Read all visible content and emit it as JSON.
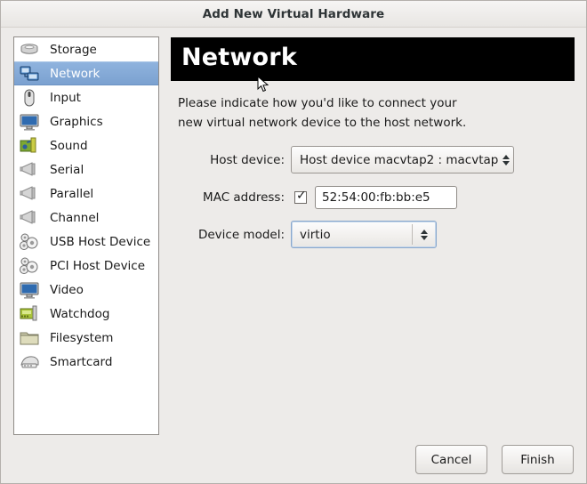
{
  "window": {
    "title": "Add New Virtual Hardware"
  },
  "sidebar": {
    "items": [
      {
        "label": "Storage",
        "icon": "storage-icon",
        "selected": false
      },
      {
        "label": "Network",
        "icon": "network-icon",
        "selected": true
      },
      {
        "label": "Input",
        "icon": "mouse-icon",
        "selected": false
      },
      {
        "label": "Graphics",
        "icon": "monitor-icon",
        "selected": false
      },
      {
        "label": "Sound",
        "icon": "sound-icon",
        "selected": false
      },
      {
        "label": "Serial",
        "icon": "serial-port-icon",
        "selected": false
      },
      {
        "label": "Parallel",
        "icon": "parallel-port-icon",
        "selected": false
      },
      {
        "label": "Channel",
        "icon": "channel-icon",
        "selected": false
      },
      {
        "label": "USB Host Device",
        "icon": "usb-host-icon",
        "selected": false
      },
      {
        "label": "PCI Host Device",
        "icon": "pci-host-icon",
        "selected": false
      },
      {
        "label": "Video",
        "icon": "video-icon",
        "selected": false
      },
      {
        "label": "Watchdog",
        "icon": "watchdog-card-icon",
        "selected": false
      },
      {
        "label": "Filesystem",
        "icon": "folder-icon",
        "selected": false
      },
      {
        "label": "Smartcard",
        "icon": "smartcard-icon",
        "selected": false
      }
    ]
  },
  "main": {
    "banner_title": "Network",
    "description": "Please indicate how you'd like to connect your\nnew virtual network device to the host network.",
    "fields": {
      "host_device": {
        "label": "Host device:",
        "value": "Host device macvtap2 : macvtap"
      },
      "mac_address": {
        "label": "MAC address:",
        "checked": true,
        "value": "52:54:00:fb:bb:e5"
      },
      "device_model": {
        "label": "Device model:",
        "value": "virtio"
      }
    }
  },
  "footer": {
    "cancel_label": "Cancel",
    "finish_label": "Finish"
  },
  "colors": {
    "selection": "#7ba1d0",
    "banner_bg": "#000000",
    "dialog_bg": "#edebe9"
  }
}
